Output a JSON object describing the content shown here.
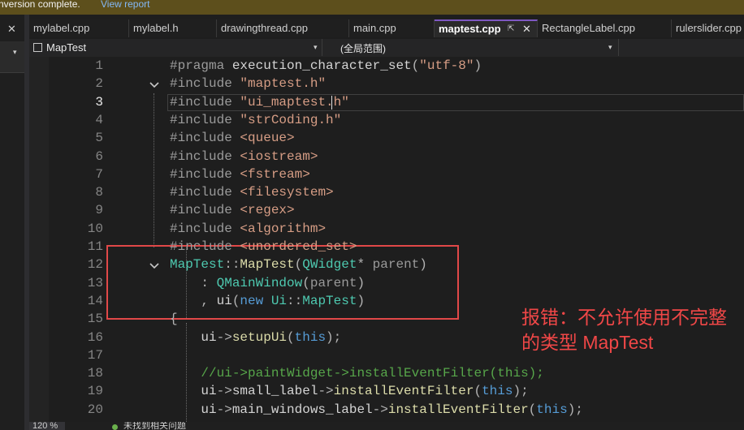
{
  "infobar": {
    "message": "nversion complete.",
    "link": "View report"
  },
  "left_pane": {
    "close_glyph": "✕",
    "dropdown_glyph": "▾"
  },
  "tabs": [
    {
      "label": "mylabel.cpp",
      "active": false
    },
    {
      "label": "mylabel.h",
      "active": false
    },
    {
      "label": "drawingthread.cpp",
      "active": false
    },
    {
      "label": "main.cpp",
      "active": false
    },
    {
      "label": "maptest.cpp",
      "active": true,
      "pin": "⇱",
      "close": "✕"
    },
    {
      "label": "RectangleLabel.cpp",
      "active": false
    },
    {
      "label": "rulerslider.cpp",
      "active": false
    }
  ],
  "navbar": {
    "project": "MapTest",
    "scope": "(全局范围)",
    "arrow": "▾"
  },
  "editor": {
    "current_line": 3,
    "lines": [
      {
        "n": "1",
        "tokens": [
          {
            "t": "#pragma ",
            "c": "pre"
          },
          {
            "t": "execution_character_set",
            "c": "mem"
          },
          {
            "t": "(",
            "c": "op"
          },
          {
            "t": "\"utf-8\"",
            "c": "str"
          },
          {
            "t": ")",
            "c": "op"
          }
        ]
      },
      {
        "n": "2",
        "fold": true,
        "tokens": [
          {
            "t": "#include ",
            "c": "pre"
          },
          {
            "t": "\"maptest.h\"",
            "c": "str"
          }
        ]
      },
      {
        "n": "3",
        "tokens": [
          {
            "t": "#include ",
            "c": "pre"
          },
          {
            "t": "\"ui_maptest.h\"",
            "c": "str"
          }
        ]
      },
      {
        "n": "4",
        "tokens": [
          {
            "t": "#include ",
            "c": "pre"
          },
          {
            "t": "\"strCoding.h\"",
            "c": "str"
          }
        ]
      },
      {
        "n": "5",
        "tokens": [
          {
            "t": "#include ",
            "c": "pre"
          },
          {
            "t": "<queue>",
            "c": "ang"
          }
        ]
      },
      {
        "n": "6",
        "tokens": [
          {
            "t": "#include ",
            "c": "pre"
          },
          {
            "t": "<iostream>",
            "c": "ang"
          }
        ]
      },
      {
        "n": "7",
        "tokens": [
          {
            "t": "#include ",
            "c": "pre"
          },
          {
            "t": "<fstream>",
            "c": "ang"
          }
        ]
      },
      {
        "n": "8",
        "tokens": [
          {
            "t": "#include ",
            "c": "pre"
          },
          {
            "t": "<filesystem>",
            "c": "ang"
          }
        ]
      },
      {
        "n": "9",
        "tokens": [
          {
            "t": "#include ",
            "c": "pre"
          },
          {
            "t": "<regex>",
            "c": "ang"
          }
        ]
      },
      {
        "n": "10",
        "tokens": [
          {
            "t": "#include ",
            "c": "pre"
          },
          {
            "t": "<algorithm>",
            "c": "ang"
          }
        ]
      },
      {
        "n": "11",
        "tokens": [
          {
            "t": "#include ",
            "c": "pre"
          },
          {
            "t": "<unordered_set>",
            "c": "ang"
          }
        ]
      },
      {
        "n": "12",
        "fold": true,
        "tokens": [
          {
            "t": "MapTest",
            "c": "type"
          },
          {
            "t": "::",
            "c": "op"
          },
          {
            "t": "MapTest",
            "c": "fn"
          },
          {
            "t": "(",
            "c": "op"
          },
          {
            "t": "QWidget",
            "c": "type"
          },
          {
            "t": "* ",
            "c": "op"
          },
          {
            "t": "parent",
            "c": "param"
          },
          {
            "t": ")",
            "c": "op"
          }
        ]
      },
      {
        "n": "13",
        "tokens": [
          {
            "t": "    : ",
            "c": "op"
          },
          {
            "t": "QMainWindow",
            "c": "type"
          },
          {
            "t": "(",
            "c": "op"
          },
          {
            "t": "parent",
            "c": "param"
          },
          {
            "t": ")",
            "c": "op"
          }
        ]
      },
      {
        "n": "14",
        "tokens": [
          {
            "t": "    , ",
            "c": "op"
          },
          {
            "t": "ui",
            "c": "mem"
          },
          {
            "t": "(",
            "c": "op"
          },
          {
            "t": "new ",
            "c": "kw"
          },
          {
            "t": "Ui",
            "c": "type"
          },
          {
            "t": "::",
            "c": "op"
          },
          {
            "t": "MapTest",
            "c": "type"
          },
          {
            "t": ")",
            "c": "op"
          }
        ]
      },
      {
        "n": "15",
        "tokens": [
          {
            "t": "{",
            "c": "op"
          }
        ]
      },
      {
        "n": "16",
        "tokens": [
          {
            "t": "    ui",
            "c": "mem"
          },
          {
            "t": "->",
            "c": "op"
          },
          {
            "t": "setupUi",
            "c": "fn"
          },
          {
            "t": "(",
            "c": "op"
          },
          {
            "t": "this",
            "c": "kw"
          },
          {
            "t": ");",
            "c": "op"
          }
        ]
      },
      {
        "n": "17",
        "tokens": []
      },
      {
        "n": "18",
        "tokens": [
          {
            "t": "    //ui->paintWidget->installEventFilter(this);",
            "c": "cmt"
          }
        ]
      },
      {
        "n": "19",
        "tokens": [
          {
            "t": "    ui",
            "c": "mem"
          },
          {
            "t": "->",
            "c": "op"
          },
          {
            "t": "small_label",
            "c": "mem"
          },
          {
            "t": "->",
            "c": "op"
          },
          {
            "t": "installEventFilter",
            "c": "fn"
          },
          {
            "t": "(",
            "c": "op"
          },
          {
            "t": "this",
            "c": "kw"
          },
          {
            "t": ");",
            "c": "op"
          }
        ]
      },
      {
        "n": "20",
        "tokens": [
          {
            "t": "    ui",
            "c": "mem"
          },
          {
            "t": "->",
            "c": "op"
          },
          {
            "t": "main_windows_label",
            "c": "mem"
          },
          {
            "t": "->",
            "c": "op"
          },
          {
            "t": "installEventFilter",
            "c": "fn"
          },
          {
            "t": "(",
            "c": "op"
          },
          {
            "t": "this",
            "c": "kw"
          },
          {
            "t": ");",
            "c": "op"
          }
        ]
      }
    ]
  },
  "annotation": {
    "line1": "报错：不允许使用不完整",
    "line2": "的类型 MapTest"
  },
  "statusbar": {
    "zoom": "120 %",
    "issues": "未找到相关问题"
  },
  "colors": {
    "accent": "#7e57c2",
    "annotation": "#f04747",
    "infobar": "#5d4f1c"
  }
}
